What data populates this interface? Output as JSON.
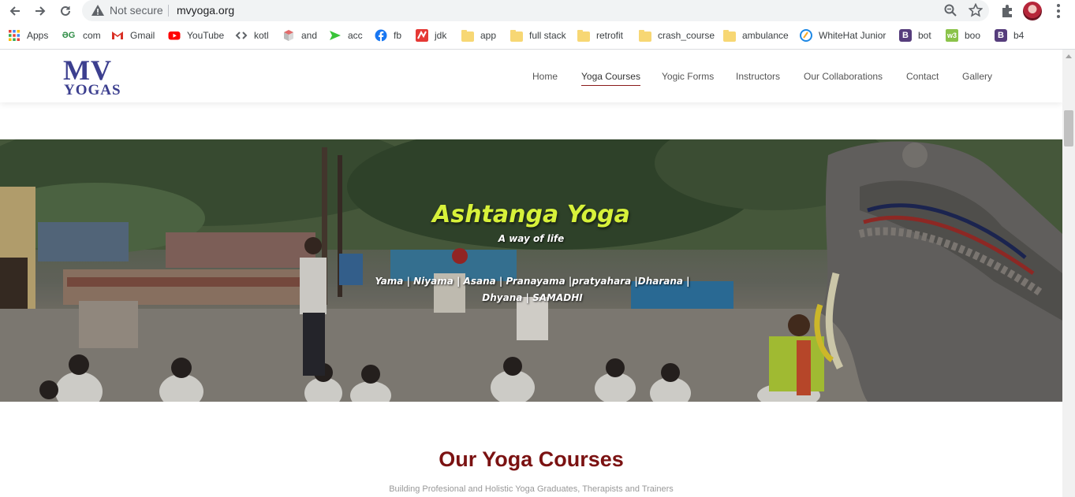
{
  "browser": {
    "security_label": "Not secure",
    "url": "mvyoga.org",
    "bookmarks": [
      {
        "label": "Apps",
        "icon": "apps-grid-icon"
      },
      {
        "label": "com",
        "icon": "gfg-icon"
      },
      {
        "label": "Gmail",
        "icon": "gmail-icon"
      },
      {
        "label": "YouTube",
        "icon": "youtube-icon"
      },
      {
        "label": "kotl",
        "icon": "code-icon"
      },
      {
        "label": "and",
        "icon": "box-icon"
      },
      {
        "label": "acc",
        "icon": "arrow-icon"
      },
      {
        "label": "fb",
        "icon": "facebook-icon"
      },
      {
        "label": "jdk",
        "icon": "java-icon"
      },
      {
        "label": "app",
        "icon": "folder-icon"
      },
      {
        "label": "full stack",
        "icon": "folder-icon"
      },
      {
        "label": "retrofit",
        "icon": "folder-icon"
      },
      {
        "label": "crash_course",
        "icon": "folder-icon"
      },
      {
        "label": "ambulance",
        "icon": "folder-icon"
      },
      {
        "label": "WhiteHat Junior",
        "icon": "whitehat-icon"
      },
      {
        "label": "bot",
        "icon": "bootstrap-icon"
      },
      {
        "label": "boo",
        "icon": "boo-icon"
      },
      {
        "label": "b4",
        "icon": "bootstrap-icon"
      }
    ]
  },
  "site": {
    "logo": {
      "line1": "MV",
      "line2": "YOGAS"
    },
    "menu": [
      {
        "label": "Home",
        "active": false
      },
      {
        "label": "Yoga Courses",
        "active": true
      },
      {
        "label": "Yogic Forms",
        "active": false
      },
      {
        "label": "Instructors",
        "active": false
      },
      {
        "label": "Our Collaborations",
        "active": false
      },
      {
        "label": "Contact",
        "active": false
      },
      {
        "label": "Gallery",
        "active": false
      }
    ],
    "hero": {
      "title": "Ashtanga Yoga",
      "subtitle": "A way of life",
      "limbs": "Yama | Niyama | Asana | Pranayama |pratyahara |Dharana | Dhyana | SAMADHI"
    },
    "courses": {
      "title": "Our Yoga Courses",
      "subtitle": "Building Profesional and Holistic Yoga Graduates, Therapists and Trainers"
    }
  },
  "colors": {
    "brand_navy": "#3c3f8f",
    "accent_maroon": "#7b1212",
    "hero_title": "#d7f13a"
  }
}
